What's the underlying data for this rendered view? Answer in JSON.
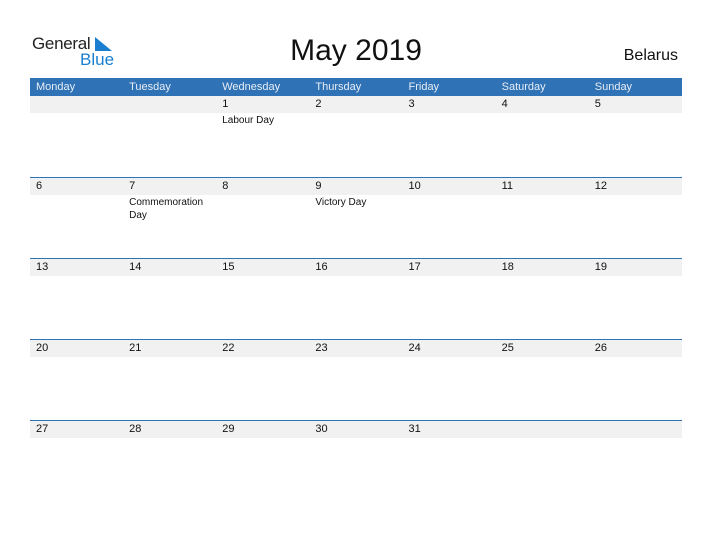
{
  "logo": {
    "line1": "General",
    "line2": "Blue",
    "icon": "triangle-flag-icon"
  },
  "title": "May 2019",
  "country": "Belarus",
  "colors": {
    "header_bg": "#2f72b5",
    "date_bar_bg": "#f1f1f1",
    "logo_blue": "#1a7fd0"
  },
  "weekdays": [
    "Monday",
    "Tuesday",
    "Wednesday",
    "Thursday",
    "Friday",
    "Saturday",
    "Sunday"
  ],
  "weeks": [
    {
      "days": [
        "",
        "",
        "1",
        "2",
        "3",
        "4",
        "5"
      ],
      "holidays": [
        "",
        "",
        "Labour Day",
        "",
        "",
        "",
        ""
      ]
    },
    {
      "days": [
        "6",
        "7",
        "8",
        "9",
        "10",
        "11",
        "12"
      ],
      "holidays": [
        "",
        "Commemoration Day",
        "",
        "Victory Day",
        "",
        "",
        ""
      ]
    },
    {
      "days": [
        "13",
        "14",
        "15",
        "16",
        "17",
        "18",
        "19"
      ],
      "holidays": [
        "",
        "",
        "",
        "",
        "",
        "",
        ""
      ]
    },
    {
      "days": [
        "20",
        "21",
        "22",
        "23",
        "24",
        "25",
        "26"
      ],
      "holidays": [
        "",
        "",
        "",
        "",
        "",
        "",
        ""
      ]
    },
    {
      "days": [
        "27",
        "28",
        "29",
        "30",
        "31",
        "",
        ""
      ],
      "holidays": [
        "",
        "",
        "",
        "",
        "",
        "",
        ""
      ]
    }
  ]
}
